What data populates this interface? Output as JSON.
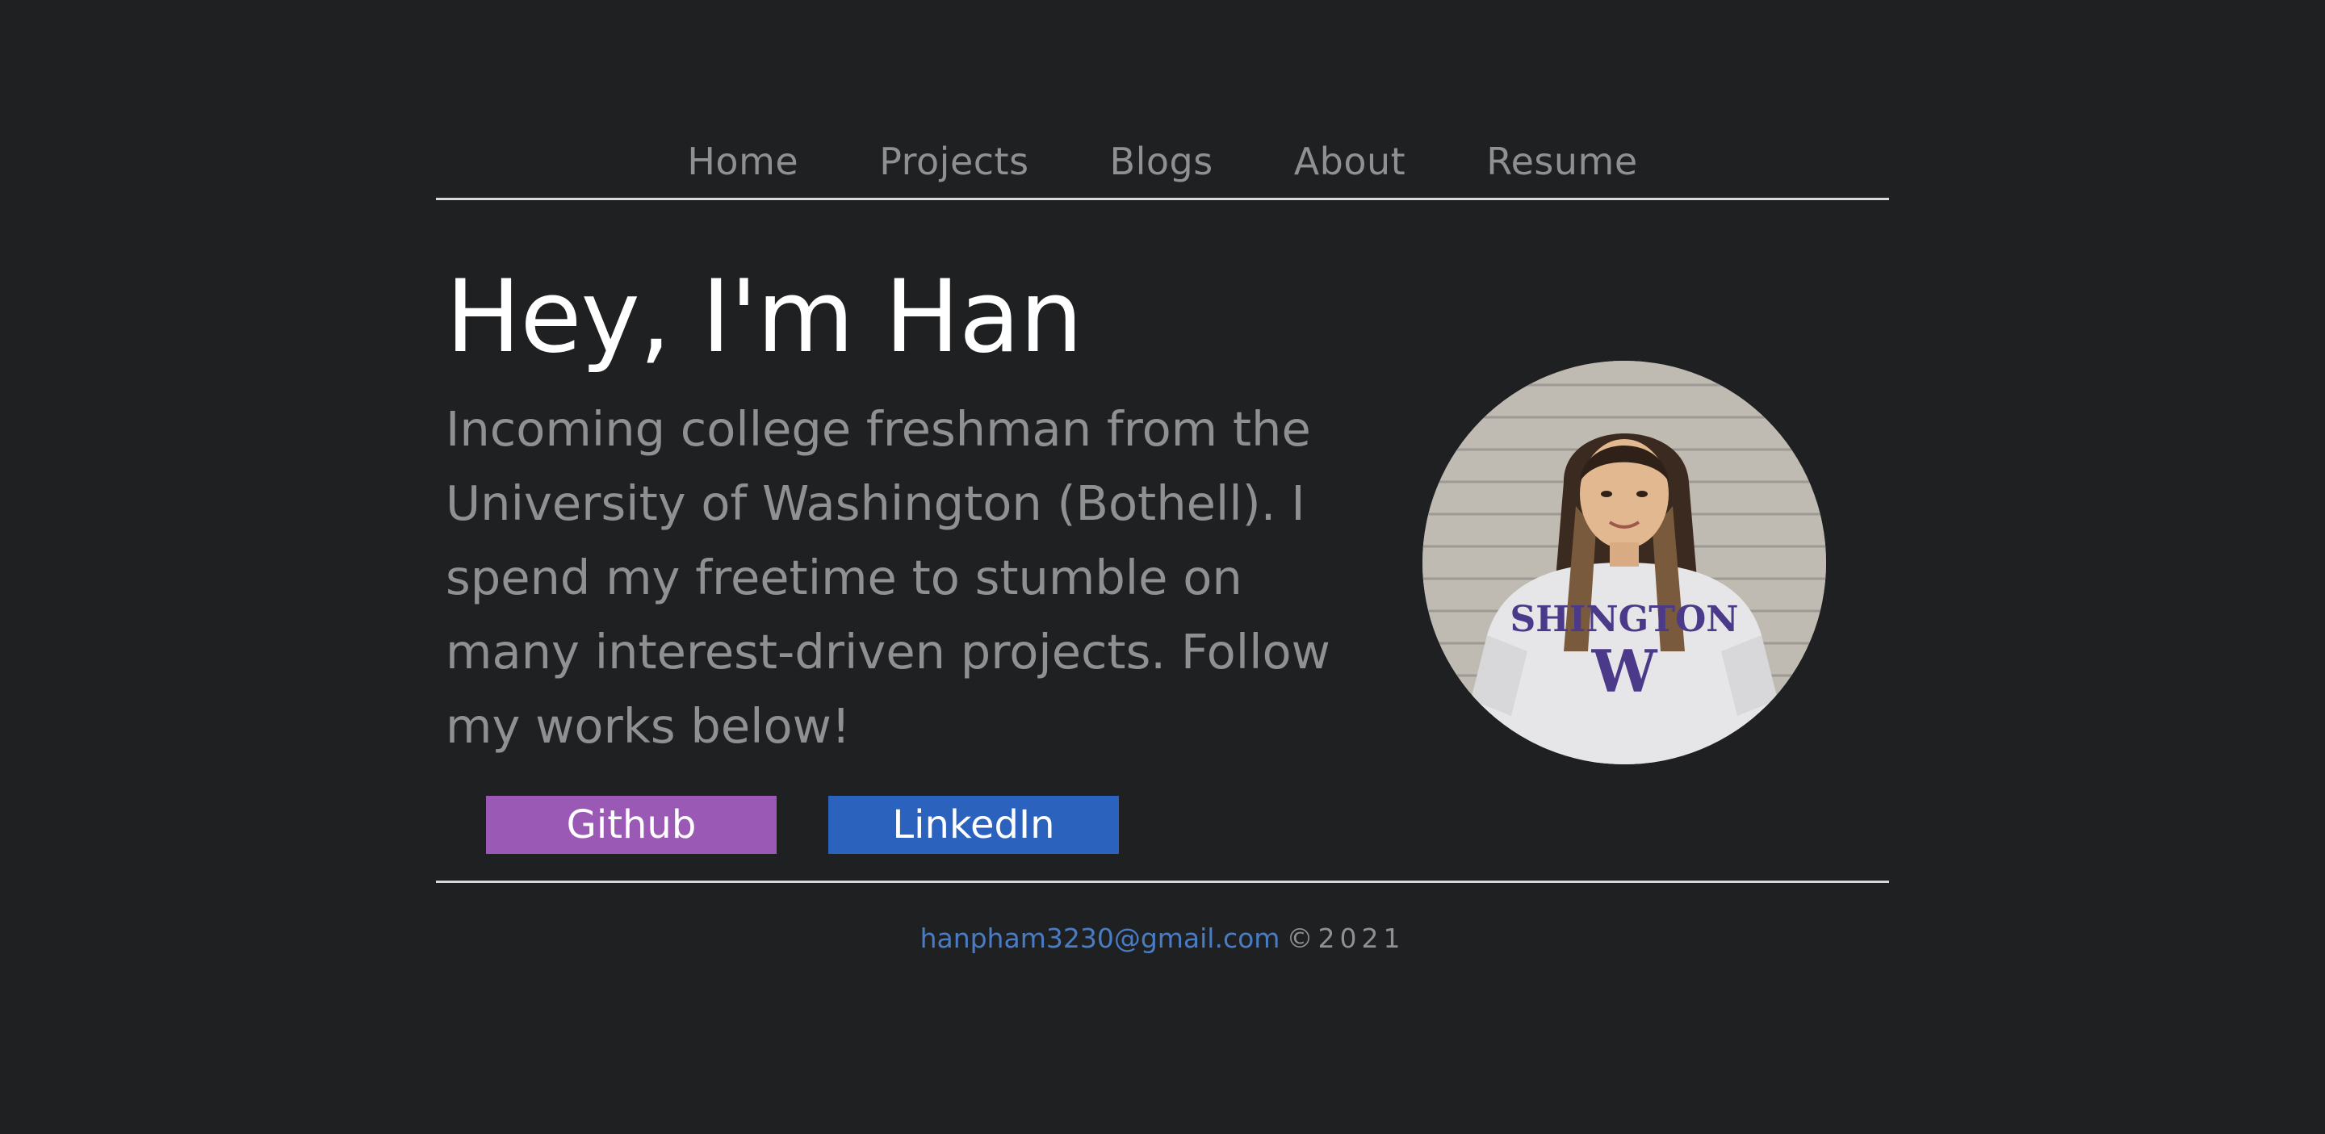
{
  "nav": {
    "items": [
      {
        "label": "Home"
      },
      {
        "label": "Projects"
      },
      {
        "label": "Blogs"
      },
      {
        "label": "About"
      },
      {
        "label": "Resume"
      }
    ]
  },
  "hero": {
    "title": "Hey, I'm Han",
    "intro": "Incoming college freshman from the University of Washington (Bothell). I spend my freetime to stumble on many interest-driven projects. Follow my works below!"
  },
  "buttons": {
    "github": "Github",
    "linkedin": "LinkedIn"
  },
  "avatar": {
    "sweatshirt_text": "SHINGTON",
    "sweatshirt_letter": "W"
  },
  "footer": {
    "email": "hanpham3230@gmail.com",
    "copyright": "©2021"
  },
  "colors": {
    "background": "#1f2022",
    "github": "#9b59b6",
    "linkedin": "#2a62bd",
    "email_link": "#4a7cc4",
    "muted_text": "#8f9092"
  }
}
